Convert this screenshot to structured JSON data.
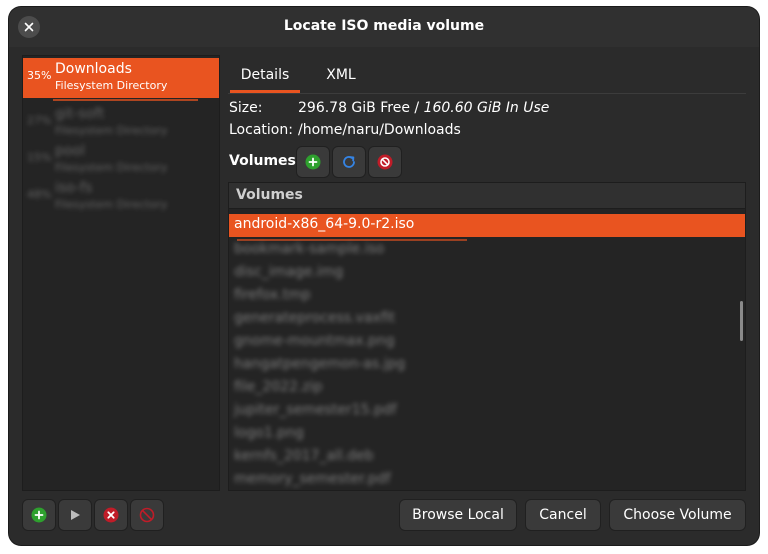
{
  "window": {
    "title": "Locate ISO media volume"
  },
  "directories": [
    {
      "percent": "35%",
      "name": "Downloads",
      "type": "Filesystem Directory",
      "selected": true
    },
    {
      "percent": "27%",
      "name": "git-soft",
      "type": "Filesystem Directory",
      "selected": false
    },
    {
      "percent": "15%",
      "name": "pool",
      "type": "Filesystem Directory",
      "selected": false
    },
    {
      "percent": "48%",
      "name": "iso-fs",
      "type": "Filesystem Directory",
      "selected": false
    }
  ],
  "tabs": [
    {
      "label": "Details",
      "active": true
    },
    {
      "label": "XML",
      "active": false
    }
  ],
  "details": {
    "size_label": "Size:",
    "size_free": "296.78 GiB Free / ",
    "size_inuse": "160.60 GiB In Use",
    "location_label": "Location:",
    "location_value": "/home/naru/Downloads"
  },
  "volumes": {
    "label": "Volumes",
    "header": "Volumes",
    "items": [
      {
        "name": "android-x86_64-9.0-r2.iso",
        "selected": true
      },
      {
        "name": "bookmark-sample.iso",
        "selected": false
      },
      {
        "name": "disc_image.img",
        "selected": false
      },
      {
        "name": "firefox.tmp",
        "selected": false
      },
      {
        "name": "generateprocess.vaxfit",
        "selected": false
      },
      {
        "name": "gnome-mountmax.png",
        "selected": false
      },
      {
        "name": "hangatpengemon-as.jpg",
        "selected": false
      },
      {
        "name": "file_2022.zip",
        "selected": false
      },
      {
        "name": "jupiter_semester15.pdf",
        "selected": false
      },
      {
        "name": "logo1.png",
        "selected": false
      },
      {
        "name": "kernfs_2017_all.deb",
        "selected": false
      },
      {
        "name": "memory_semester.pdf",
        "selected": false
      }
    ]
  },
  "buttons": {
    "browse_local": "Browse Local",
    "cancel": "Cancel",
    "choose_volume": "Choose Volume"
  },
  "colors": {
    "accent": "#e95420",
    "add": "#2ea02e",
    "refresh": "#3584e4",
    "delete": "#c01c28"
  },
  "icons": [
    "close-icon",
    "add-icon",
    "refresh-icon",
    "stop-icon",
    "play-icon",
    "delete-icon"
  ]
}
